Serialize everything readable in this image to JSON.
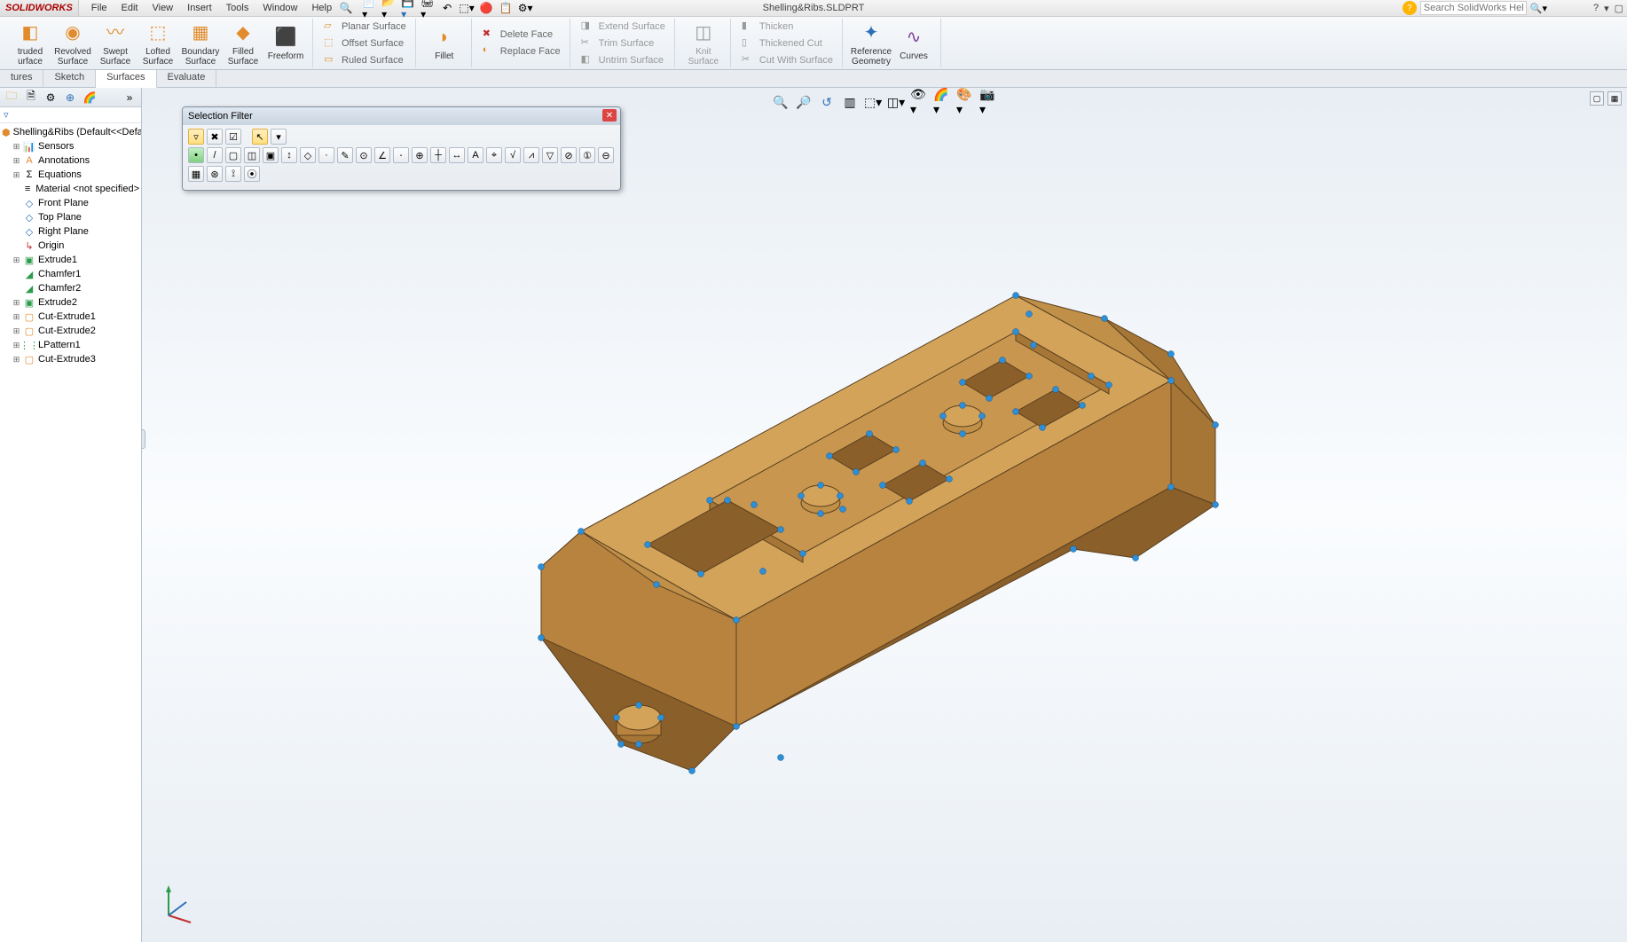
{
  "app": {
    "logo": "SOLIDWORKS",
    "doc_title": "Shelling&Ribs.SLDPRT"
  },
  "menu": {
    "file": "File",
    "edit": "Edit",
    "view": "View",
    "insert": "Insert",
    "tools": "Tools",
    "window": "Window",
    "help": "Help"
  },
  "search": {
    "placeholder": "Search SolidWorks Help"
  },
  "ribbon": {
    "extruded": "truded\nurface",
    "revolved": "Revolved\nSurface",
    "swept": "Swept\nSurface",
    "lofted": "Lofted\nSurface",
    "boundary": "Boundary\nSurface",
    "filled": "Filled\nSurface",
    "freeform": "Freeform",
    "planar": "Planar Surface",
    "offset": "Offset Surface",
    "ruled": "Ruled Surface",
    "fillet": "Fillet",
    "deleteface": "Delete Face",
    "replaceface": "Replace Face",
    "extend": "Extend Surface",
    "trim": "Trim Surface",
    "untrim": "Untrim Surface",
    "knit": "Knit\nSurface",
    "thicken": "Thicken",
    "thickencut": "Thickened Cut",
    "cutwith": "Cut With Surface",
    "refgeo": "Reference\nGeometry",
    "curves": "Curves"
  },
  "tabs": {
    "features": "tures",
    "sketch": "Sketch",
    "surfaces": "Surfaces",
    "evaluate": "Evaluate"
  },
  "tree": {
    "root": "Shelling&Ribs (Default<<Defau",
    "sensors": "Sensors",
    "annotations": "Annotations",
    "equations": "Equations",
    "material": "Material <not specified>",
    "front": "Front Plane",
    "top": "Top Plane",
    "right": "Right Plane",
    "origin": "Origin",
    "f": [
      "Extrude1",
      "Chamfer1",
      "Chamfer2",
      "Extrude2",
      "Cut-Extrude1",
      "Cut-Extrude2",
      "LPattern1",
      "Cut-Extrude3"
    ]
  },
  "selfilter": {
    "title": "Selection Filter"
  },
  "colors": {
    "model_top": "#d4a35a",
    "model_side": "#b8833e",
    "model_side2": "#a67636",
    "model_dark": "#8a5f2a",
    "edge": "#5a4020",
    "vertex": "#2c8fd8"
  }
}
